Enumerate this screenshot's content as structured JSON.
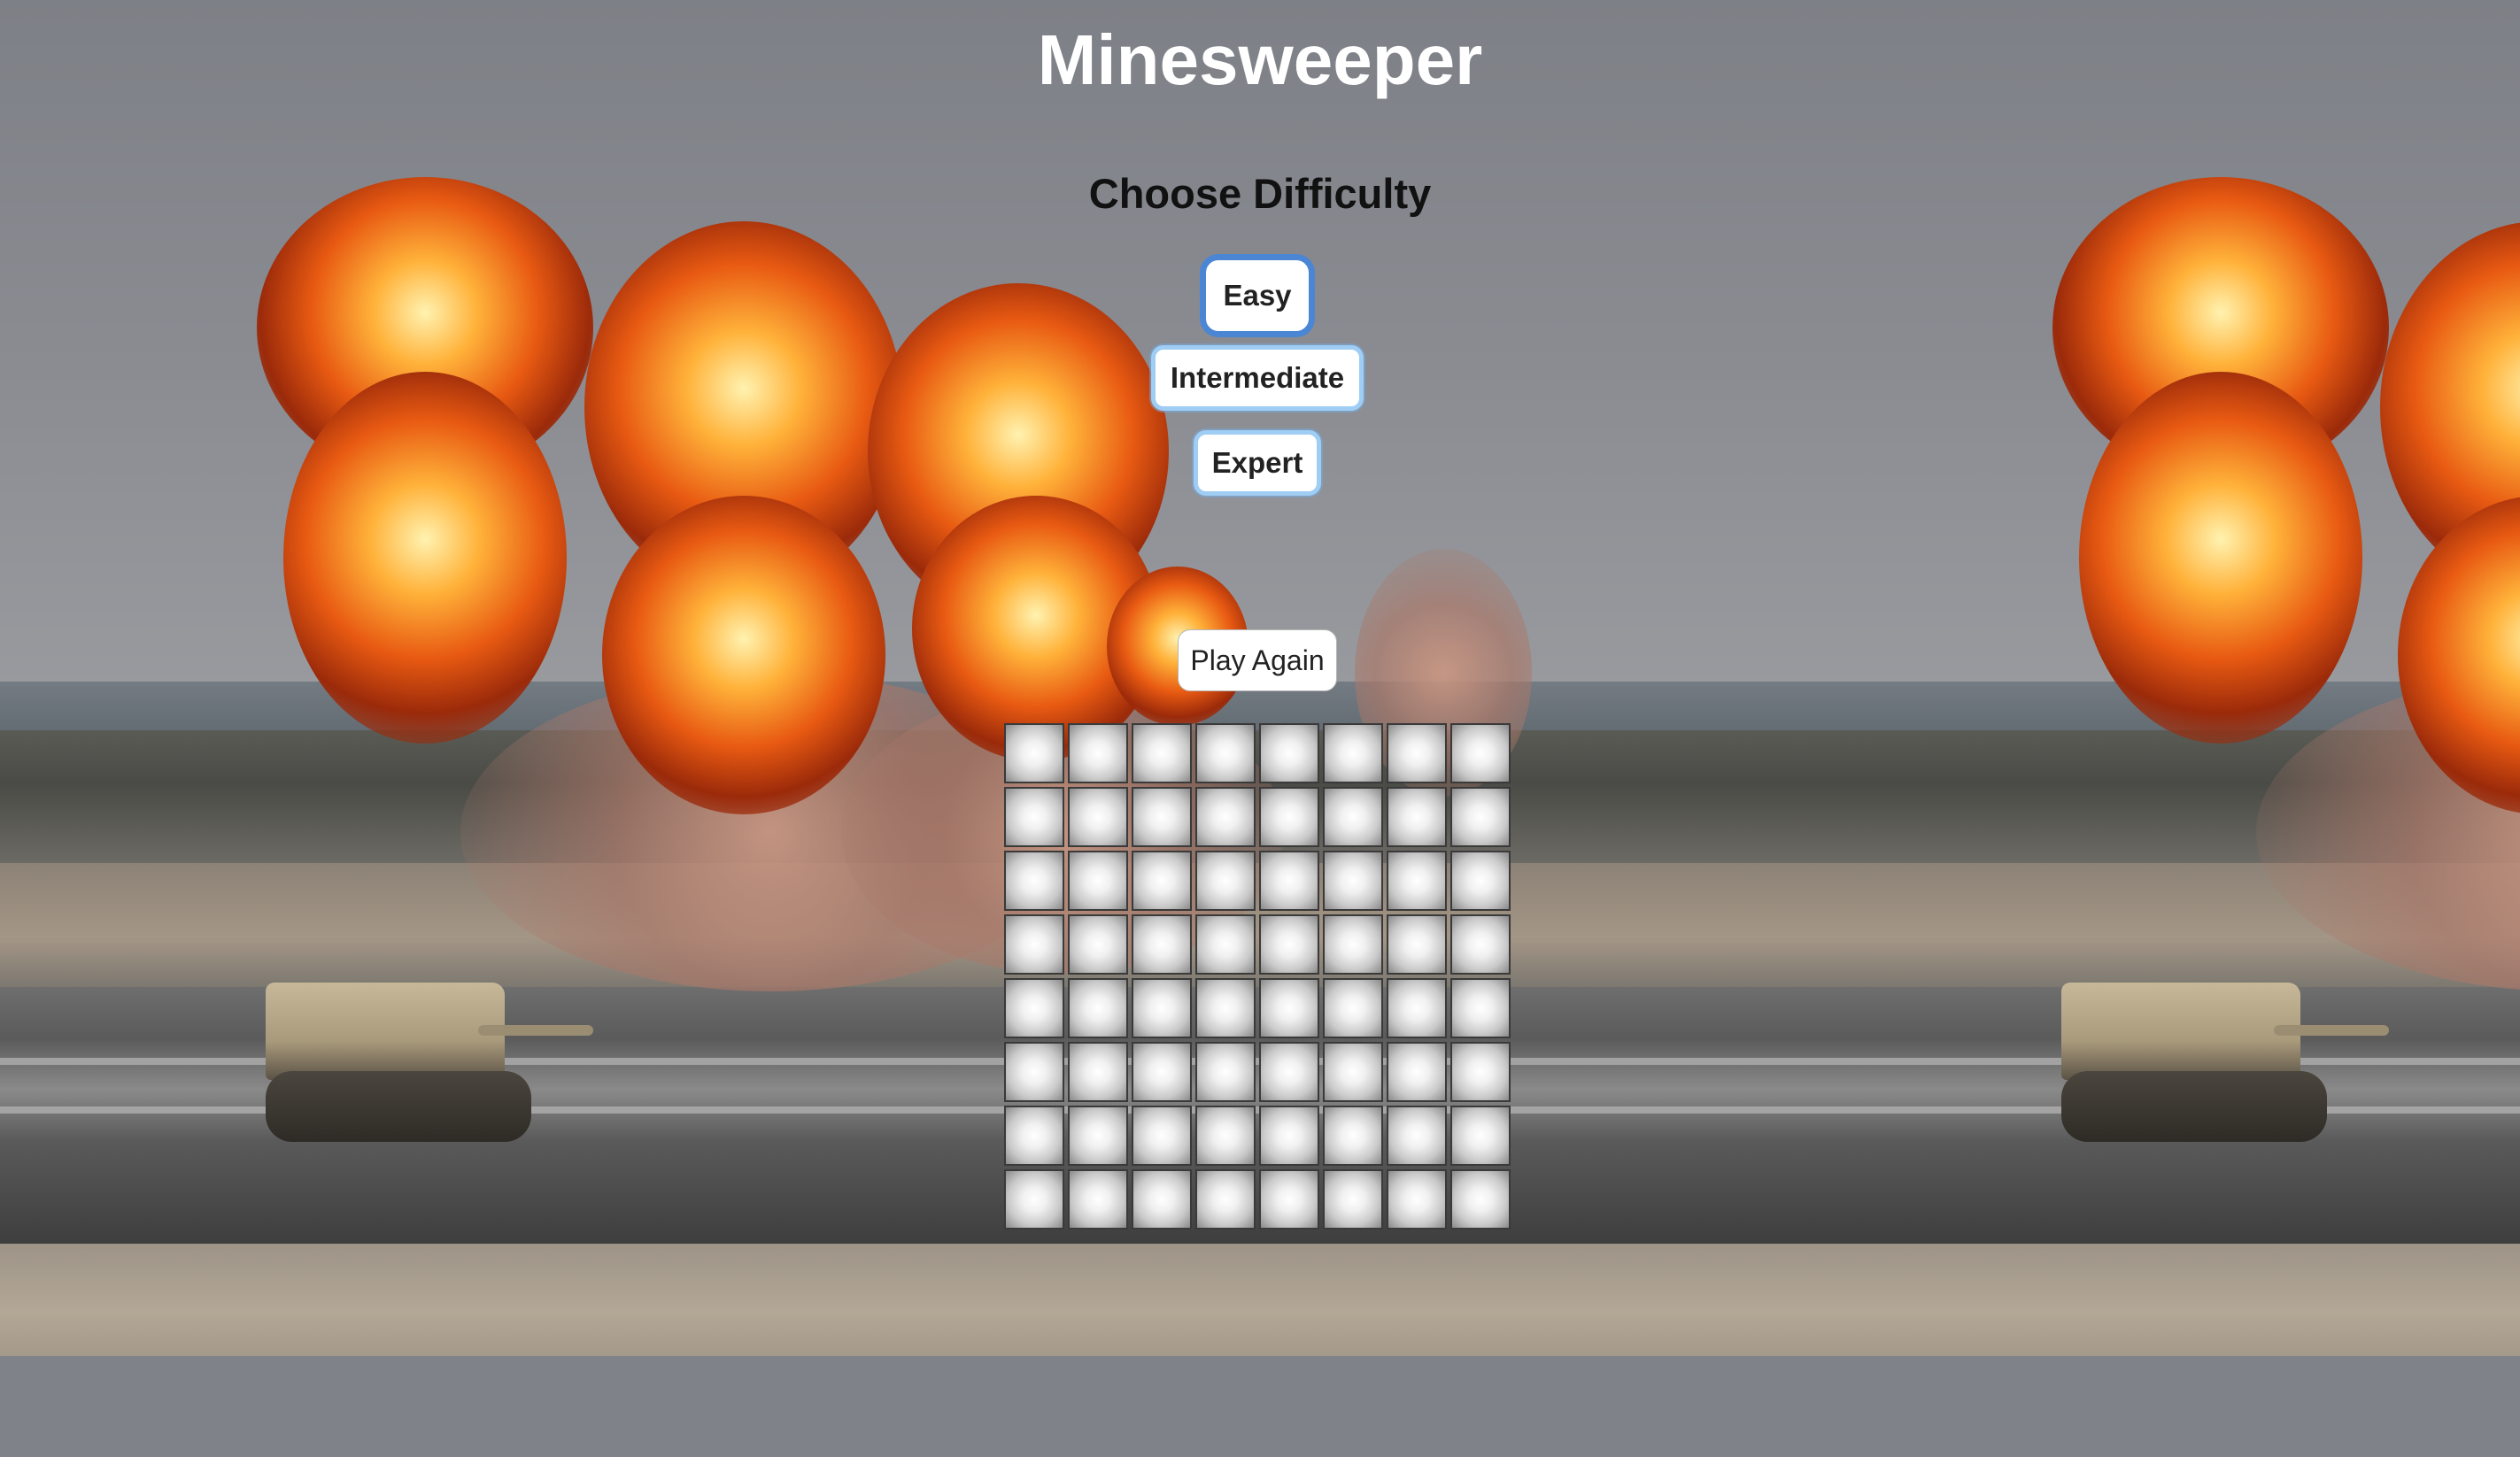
{
  "game": {
    "title": "Minesweeper",
    "subtitle": "Choose Difficulty",
    "selected_difficulty": "Easy"
  },
  "difficulty_buttons": {
    "easy": "Easy",
    "intermediate": "Intermediate",
    "expert": "Expert"
  },
  "play_again_label": "Play Again",
  "board": {
    "rows": 8,
    "cols": 8,
    "state": "all-unrevealed"
  },
  "colors": {
    "title": "#ffffff",
    "button_border": "#9fcdf4",
    "selected_ring": "#4a86d4"
  }
}
